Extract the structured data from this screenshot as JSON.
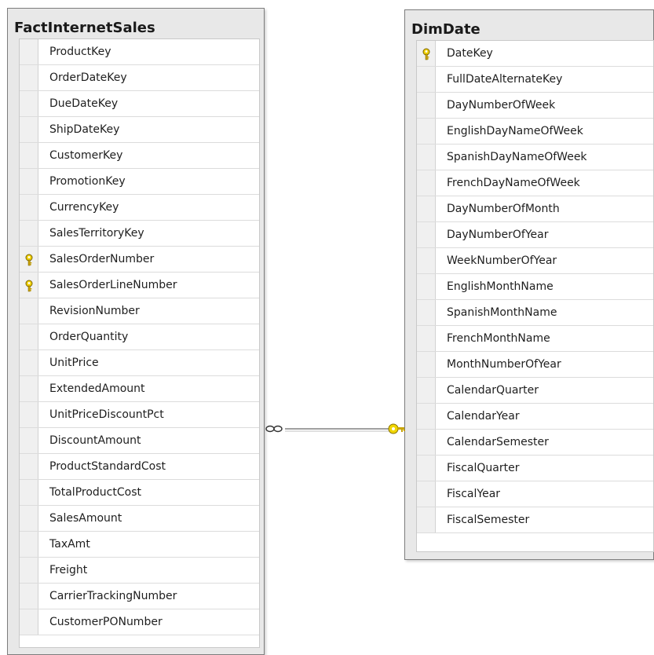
{
  "fact_table": {
    "title": "FactInternetSales",
    "columns": [
      {
        "name": "ProductKey",
        "is_key": false
      },
      {
        "name": "OrderDateKey",
        "is_key": false
      },
      {
        "name": "DueDateKey",
        "is_key": false
      },
      {
        "name": "ShipDateKey",
        "is_key": false
      },
      {
        "name": "CustomerKey",
        "is_key": false
      },
      {
        "name": "PromotionKey",
        "is_key": false
      },
      {
        "name": "CurrencyKey",
        "is_key": false
      },
      {
        "name": "SalesTerritoryKey",
        "is_key": false
      },
      {
        "name": "SalesOrderNumber",
        "is_key": true
      },
      {
        "name": "SalesOrderLineNumber",
        "is_key": true
      },
      {
        "name": "RevisionNumber",
        "is_key": false
      },
      {
        "name": "OrderQuantity",
        "is_key": false
      },
      {
        "name": "UnitPrice",
        "is_key": false
      },
      {
        "name": "ExtendedAmount",
        "is_key": false
      },
      {
        "name": "UnitPriceDiscountPct",
        "is_key": false
      },
      {
        "name": "DiscountAmount",
        "is_key": false
      },
      {
        "name": "ProductStandardCost",
        "is_key": false
      },
      {
        "name": "TotalProductCost",
        "is_key": false
      },
      {
        "name": "SalesAmount",
        "is_key": false
      },
      {
        "name": "TaxAmt",
        "is_key": false
      },
      {
        "name": "Freight",
        "is_key": false
      },
      {
        "name": "CarrierTrackingNumber",
        "is_key": false
      },
      {
        "name": "CustomerPONumber",
        "is_key": false
      }
    ]
  },
  "dim_table": {
    "title": "DimDate",
    "columns": [
      {
        "name": "DateKey",
        "is_key": true
      },
      {
        "name": "FullDateAlternateKey",
        "is_key": false
      },
      {
        "name": "DayNumberOfWeek",
        "is_key": false
      },
      {
        "name": "EnglishDayNameOfWeek",
        "is_key": false
      },
      {
        "name": "SpanishDayNameOfWeek",
        "is_key": false
      },
      {
        "name": "FrenchDayNameOfWeek",
        "is_key": false
      },
      {
        "name": "DayNumberOfMonth",
        "is_key": false
      },
      {
        "name": "DayNumberOfYear",
        "is_key": false
      },
      {
        "name": "WeekNumberOfYear",
        "is_key": false
      },
      {
        "name": "EnglishMonthName",
        "is_key": false
      },
      {
        "name": "SpanishMonthName",
        "is_key": false
      },
      {
        "name": "FrenchMonthName",
        "is_key": false
      },
      {
        "name": "MonthNumberOfYear",
        "is_key": false
      },
      {
        "name": "CalendarQuarter",
        "is_key": false
      },
      {
        "name": "CalendarYear",
        "is_key": false
      },
      {
        "name": "CalendarSemester",
        "is_key": false
      },
      {
        "name": "FiscalQuarter",
        "is_key": false
      },
      {
        "name": "FiscalYear",
        "is_key": false
      },
      {
        "name": "FiscalSemester",
        "is_key": false
      }
    ]
  },
  "relationship": {
    "from_end": "many",
    "to_end": "one",
    "line_color": "#808080",
    "key_color": "#e8c700"
  },
  "icons": {
    "primary_key": "key-icon",
    "many_end": "infinity-icon",
    "one_end": "key-icon"
  }
}
